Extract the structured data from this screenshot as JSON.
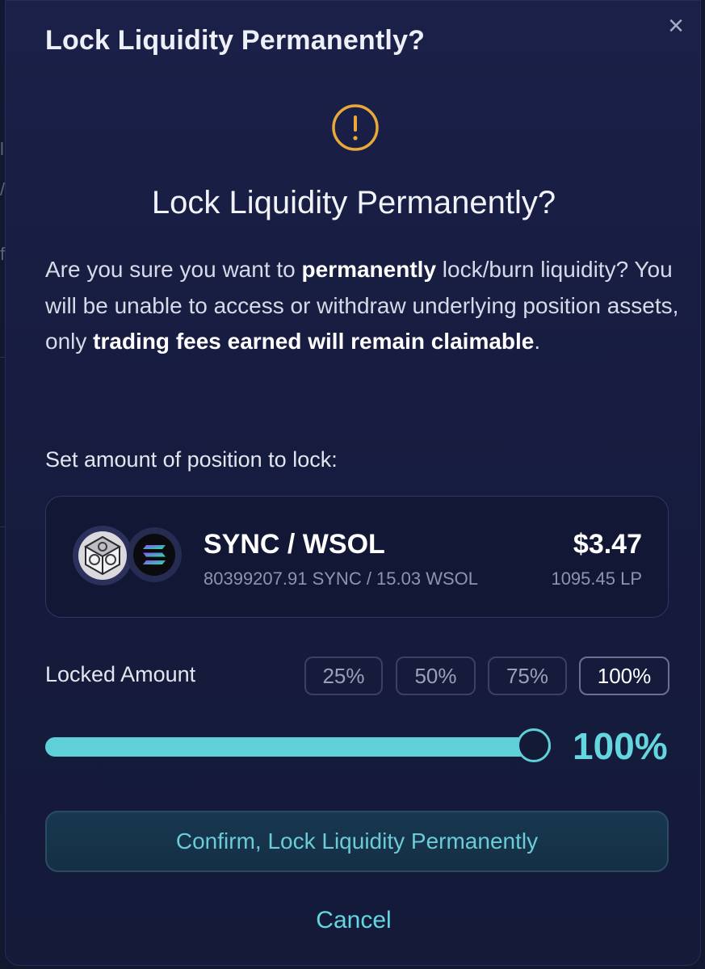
{
  "modal": {
    "header_title": "Lock Liquidity Permanently?",
    "close_glyph": "×",
    "title": "Lock Liquidity Permanently?",
    "description": {
      "part1": "Are you sure you want to ",
      "bold1": "permanently",
      "part2": " lock/burn liquidity? You will be unable to access or withdraw underlying position assets, only ",
      "bold2": "trading fees earned will remain claimable",
      "part3": "."
    },
    "set_amount_label": "Set amount of position to lock:"
  },
  "position": {
    "pair": "SYNC / WSOL",
    "amounts": "80399207.91 SYNC / 15.03 WSOL",
    "usd_value": "$3.47",
    "lp_amount": "1095.45 LP",
    "token1_icon": "sync-token-icon",
    "token2_icon": "solana-token-icon"
  },
  "lock": {
    "label": "Locked Amount",
    "presets": [
      "25%",
      "50%",
      "75%",
      "100%"
    ],
    "selected_preset": "100%",
    "slider_percent": 100,
    "slider_value_text": "100%"
  },
  "actions": {
    "confirm_label": "Confirm, Lock Liquidity Permanently",
    "cancel_label": "Cancel"
  },
  "colors": {
    "accent": "#5fd0d8",
    "warning": "#e8a93a",
    "modal_bg": "#1a2048"
  },
  "icons": {
    "warning": "warning-circle-icon",
    "close": "close-icon"
  }
}
